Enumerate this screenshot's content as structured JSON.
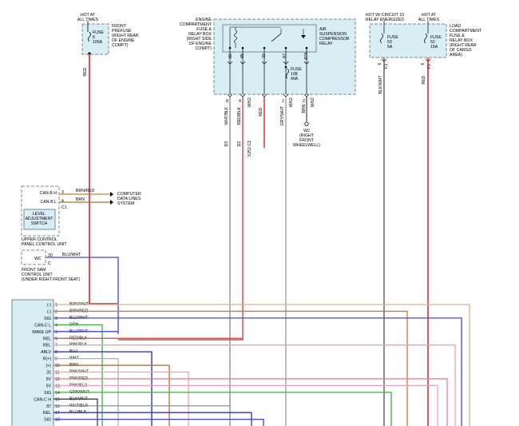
{
  "top": {
    "hot_all_times_1": [
      "HOT AT",
      "ALL TIMES"
    ],
    "hot_circuit15": [
      "HOT W/ CIRCUIT 15",
      "RELAY ENERGIZED"
    ],
    "hot_all_times_2": [
      "HOT AT",
      "ALL TIMES"
    ]
  },
  "prefuse": {
    "fuse_label": [
      "FUSE",
      "6",
      "100A"
    ],
    "desc": [
      "FRONT",
      "PREFUSE",
      "(RIGHT REAR",
      "OF ENGINE",
      "COMPT)"
    ],
    "wire": "RED"
  },
  "relay_box": {
    "desc": [
      "ENGINE",
      "COMPARTMENT",
      "FUSE &",
      "RELAY BOX",
      "(RIGHT SIDE",
      "OF ENGINE",
      "COMPT)"
    ],
    "relay_desc": [
      "AIR",
      "SUSPENSION",
      "COMPRESSOR",
      "RELAY"
    ],
    "pins": [
      "86",
      "85",
      "30",
      "87",
      "87A"
    ],
    "fuse": [
      "FUSE",
      "108",
      "40A"
    ],
    "out_pins": [
      "8",
      "4",
      "1",
      "3",
      "2"
    ],
    "out_wires": [
      "WHT/BLK",
      "RED/BLK",
      "RED",
      "GRY/WHT",
      "BRN"
    ],
    "out_conn": [
      "M/62",
      "M/62",
      "M/62",
      "M/62"
    ],
    "drops": [
      "D3",
      "D2",
      "X252-C2"
    ],
    "ground": [
      "W2",
      "(RIGHT",
      "FRONT",
      "WHEELWELL)"
    ]
  },
  "load_box": {
    "desc": [
      "LOAD",
      "COMPARTMENT",
      "FUSE &",
      "RELAY BOX",
      "(RIGHT REAR",
      "OF CARGO",
      "AREA)"
    ],
    "fuse53": [
      "FUSE",
      "53",
      "5A"
    ],
    "fuse52": [
      "FUSE",
      "52",
      "15A"
    ],
    "pins": [
      "P3",
      "P2"
    ],
    "pin_nums": [
      "6",
      "6"
    ],
    "wires": [
      "BLK/WHT",
      "RED"
    ]
  },
  "upper_panel": {
    "rows": [
      "CAN-B H",
      "CAN-B L"
    ],
    "pins": [
      "3",
      "4"
    ],
    "wires": [
      "BRN/RED",
      "BRN"
    ],
    "conn": "C1",
    "switch": [
      "LEVEL",
      "ADJUSTMENT",
      "SWITCH"
    ],
    "desc": [
      "UPPER CONTROL",
      "PANEL CONTROL UNIT"
    ],
    "computer": [
      "COMPUTER",
      "DATA LINES",
      "SYSTEM"
    ]
  },
  "front_sam": {
    "label": "WC",
    "pin": "20",
    "conn": "C",
    "wire": "BLU/WHT",
    "desc": [
      "FRONT SAM",
      "CONTROL UNIT",
      "(UNDER RIGHT FRONT SEAT)"
    ]
  },
  "module": {
    "rows": [
      {
        "label": "(-)",
        "pin": "1",
        "wire": "BRN/WHT",
        "color": "#d8b48c"
      },
      {
        "label": "(-)",
        "pin": "2",
        "wire": "BRN/RED",
        "color": "#c87a3c"
      },
      {
        "label": "SIG",
        "pin": "3",
        "wire": "BLU/WHT",
        "color": "#4040ff"
      },
      {
        "label": "CAN-C L",
        "pin": "4",
        "wire": "GRN",
        "color": "#40b040"
      },
      {
        "label": "WAKE UP",
        "pin": "5",
        "wire": "BLU/WHT",
        "color": "#4040ff"
      },
      {
        "label": "REL",
        "pin": "6",
        "wire": "RED/BLK",
        "color": "#e04040"
      },
      {
        "label": "REL",
        "pin": "7",
        "wire": "PNK/BLK",
        "color": "#f0a0b0"
      },
      {
        "label": "ABLV",
        "pin": "8",
        "wire": "BLU",
        "color": "#2020e0"
      },
      {
        "label": "R(+)",
        "pin": "9",
        "wire": "WHT",
        "color": "#b0b0b0"
      },
      {
        "label": "(+)",
        "pin": "10",
        "wire": "BRN",
        "color": "#b07030"
      },
      {
        "label": "31",
        "pin": "11",
        "wire": "PNK/WHT",
        "color": "#f0a0b0"
      },
      {
        "label": "5V",
        "pin": "12",
        "wire": "PNK/RED",
        "color": "#f08090"
      },
      {
        "label": "5V",
        "pin": "13",
        "wire": "PNK/BLU",
        "color": "#f0a0c0"
      },
      {
        "label": "SIG",
        "pin": "14",
        "wire": "GRN/WHT",
        "color": "#40b040"
      },
      {
        "label": "CAN-C H",
        "pin": "15",
        "wire": "BLK/WHT",
        "color": "#404040"
      },
      {
        "label": "87",
        "pin": "16",
        "wire": "WHT/BLK",
        "color": "#909090"
      },
      {
        "label": "REL",
        "pin": "17",
        "wire": "BLU/BLK",
        "color": "#3030d0"
      },
      {
        "label": "SIG",
        "pin": "18",
        "wire": "",
        "color": "#4040ff"
      }
    ]
  }
}
